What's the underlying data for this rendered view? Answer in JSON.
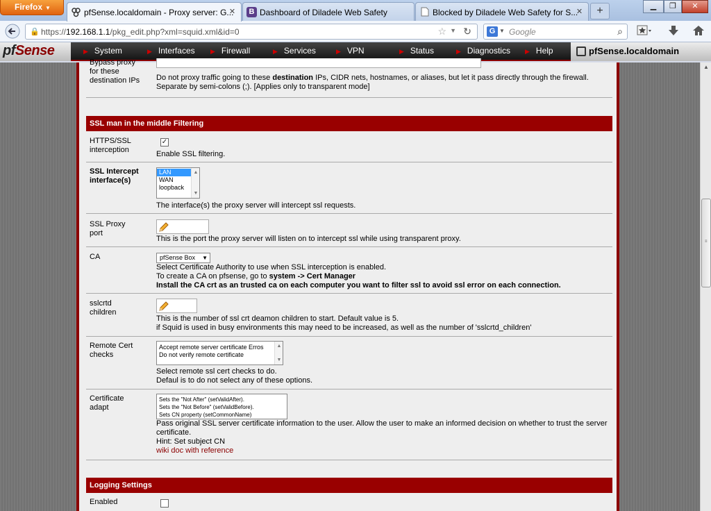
{
  "browser": {
    "app_button": "Firefox",
    "tabs": [
      {
        "title": "pfSense.localdomain - Proxy server: G...",
        "icon": "pfsense-logo-icon",
        "active": true
      },
      {
        "title": "Dashboard of Diladele Web Safety",
        "icon": "bootstrap-b-icon",
        "active": false
      },
      {
        "title": "Blocked by Diladele Web Safety for S...",
        "icon": "blank-page-icon",
        "active": false
      }
    ],
    "new_tab_label": "+",
    "url_prefix": "https://",
    "url_host": "192.168.1.1",
    "url_path": "/pkg_edit.php?xml=squid.xml&id=0",
    "search_engine": "G",
    "search_placeholder": "Google"
  },
  "pfsense_nav": {
    "logo_pf": "pf",
    "logo_sense": "Sense",
    "items": [
      "System",
      "Interfaces",
      "Firewall",
      "Services",
      "VPN",
      "Status",
      "Diagnostics",
      "Help"
    ],
    "hostname": "pfSense.localdomain"
  },
  "form": {
    "bypass": {
      "label": "Bypass proxy for these destination IPs",
      "desc_pre": "Do not proxy traffic going to these ",
      "desc_bold": "destination",
      "desc_post": " IPs, CIDR nets, hostnames, or aliases, but let it pass directly through the firewall.",
      "desc_line2": "Separate by semi-colons (;). [Applies only to transparent mode]"
    },
    "ssl_section_title": "SSL man in the middle Filtering",
    "https_ssl": {
      "label": "HTTPS/SSL interception",
      "checked": true,
      "check_mark": "✓",
      "desc": "Enable SSL filtering."
    },
    "ssl_intercept_if": {
      "label": "SSL Intercept interface(s)",
      "options": [
        "LAN",
        "WAN",
        "loopback"
      ],
      "selected": "LAN",
      "desc": "The interface(s) the proxy server will intercept ssl requests."
    },
    "ssl_proxy_port": {
      "label": "SSL Proxy port",
      "value": "",
      "desc": "This is the port the proxy server will listen on to intercept ssl while using transparent proxy."
    },
    "ca": {
      "label": "CA",
      "selected": "pfSense Box",
      "desc1": "Select Certificate Authority to use when SSL interception is enabled.",
      "desc2_pre": "To create a CA on pfsense, go to ",
      "desc2_bold": "system -> Cert Manager",
      "desc3": "Install the CA crt as an trusted ca on each computer you want to filter ssl to avoid ssl error on each connection."
    },
    "sslcrtd": {
      "label": "sslcrtd children",
      "value": "",
      "desc1": "This is the number of ssl crt deamon children to start. Default value is 5.",
      "desc2": "if Squid is used in busy environments this may need to be increased, as well as the number of 'sslcrtd_children'"
    },
    "remote_cert": {
      "label": "Remote Cert checks",
      "options": [
        "Accept remote server certificate Erros",
        "Do not verify remote certificate"
      ],
      "desc1": "Select remote ssl cert checks to do.",
      "desc2": "Defaul is to do not select any of these options."
    },
    "cert_adapt": {
      "label": "Certificate adapt",
      "options": [
        "Sets the \"Not After\" (setValidAfter).",
        "Sets the \"Not Before\" (setValidBefore).",
        "Sets CN property (setCommonName)"
      ],
      "desc1": "Pass original SSL server certificate information to the user. Allow the user to make an informed decision on whether to trust the server",
      "desc2": "certificate.",
      "desc3": "Hint: Set subject CN",
      "link": "wiki doc with reference"
    },
    "logging_section_title": "Logging Settings",
    "enabled": {
      "label": "Enabled",
      "checked": false
    }
  },
  "colors": {
    "section_bg": "#990000",
    "accent_red": "#8b0000",
    "selected_option": "#3399ff"
  }
}
